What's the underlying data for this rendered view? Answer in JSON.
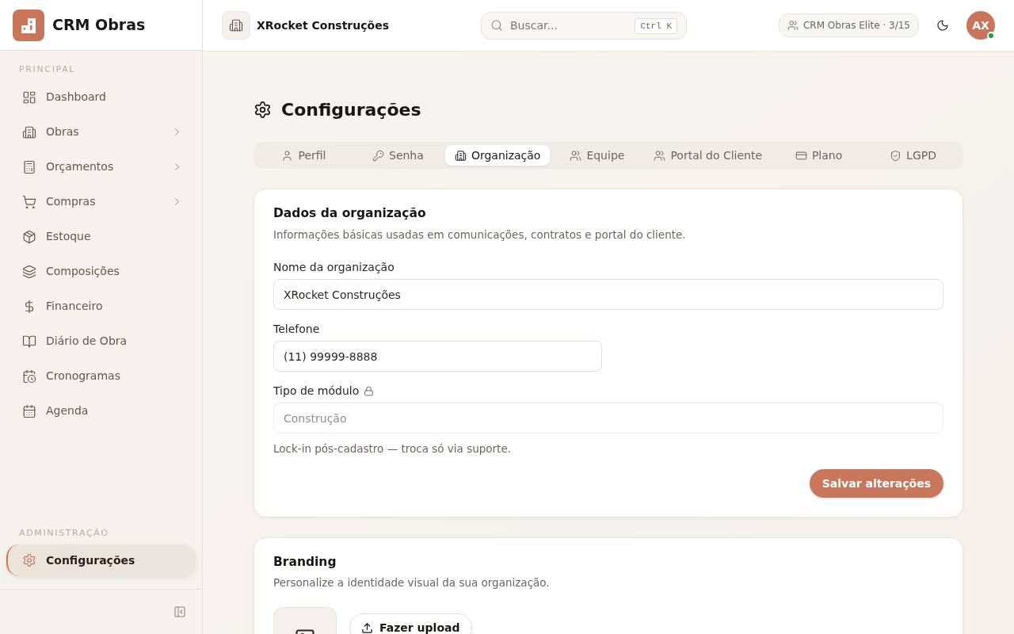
{
  "app": {
    "name": "CRM Obras"
  },
  "sidebar": {
    "sections": [
      {
        "title": "PRINCIPAL",
        "items": [
          {
            "label": "Dashboard",
            "expandable": false,
            "selected": false
          },
          {
            "label": "Obras",
            "expandable": true,
            "selected": false
          },
          {
            "label": "Orçamentos",
            "expandable": true,
            "selected": false
          },
          {
            "label": "Compras",
            "expandable": true,
            "selected": false
          },
          {
            "label": "Estoque",
            "expandable": false,
            "selected": false
          },
          {
            "label": "Composições",
            "expandable": false,
            "selected": false
          },
          {
            "label": "Financeiro",
            "expandable": false,
            "selected": false
          },
          {
            "label": "Diário de Obra",
            "expandable": false,
            "selected": false
          },
          {
            "label": "Cronogramas",
            "expandable": false,
            "selected": false
          },
          {
            "label": "Agenda",
            "expandable": false,
            "selected": false
          }
        ]
      },
      {
        "title": "ADMINISTRAÇÃO",
        "items": [
          {
            "label": "Configurações",
            "expandable": false,
            "selected": true
          }
        ]
      }
    ]
  },
  "header": {
    "organization": "XRocket Construções",
    "search": {
      "placeholder": "Buscar...",
      "shortcut": "Ctrl K"
    },
    "plan_badge": "CRM Obras Elite · 3/15",
    "user": {
      "initials": "AX",
      "online": true
    }
  },
  "page": {
    "title": "Configurações",
    "tabs": [
      {
        "label": "Perfil",
        "selected": false
      },
      {
        "label": "Senha",
        "selected": false
      },
      {
        "label": "Organização",
        "selected": true
      },
      {
        "label": "Equipe",
        "selected": false
      },
      {
        "label": "Portal do Cliente",
        "selected": false
      },
      {
        "label": "Plano",
        "selected": false
      },
      {
        "label": "LGPD",
        "selected": false
      }
    ]
  },
  "organization_card": {
    "title": "Dados da organização",
    "description": "Informações básicas usadas em comunicações, contratos e portal do cliente.",
    "fields": [
      {
        "kind": "text",
        "label": "Nome da organização",
        "value": "XRocket Construções",
        "disabled": false
      },
      {
        "kind": "phone",
        "label": "Telefone",
        "value": "(11) 99999-8888",
        "disabled": false
      },
      {
        "kind": "text",
        "label": "Tipo de módulo",
        "value": "Construção",
        "disabled": true,
        "hint": "Lock-in pós-cadastro — troca só via suporte."
      }
    ],
    "submit_button": "Salvar alterações"
  },
  "branding_card": {
    "title": "Branding",
    "description": "Personalize a identidade visual da sua organização.",
    "upload_button": "Fazer upload"
  }
}
